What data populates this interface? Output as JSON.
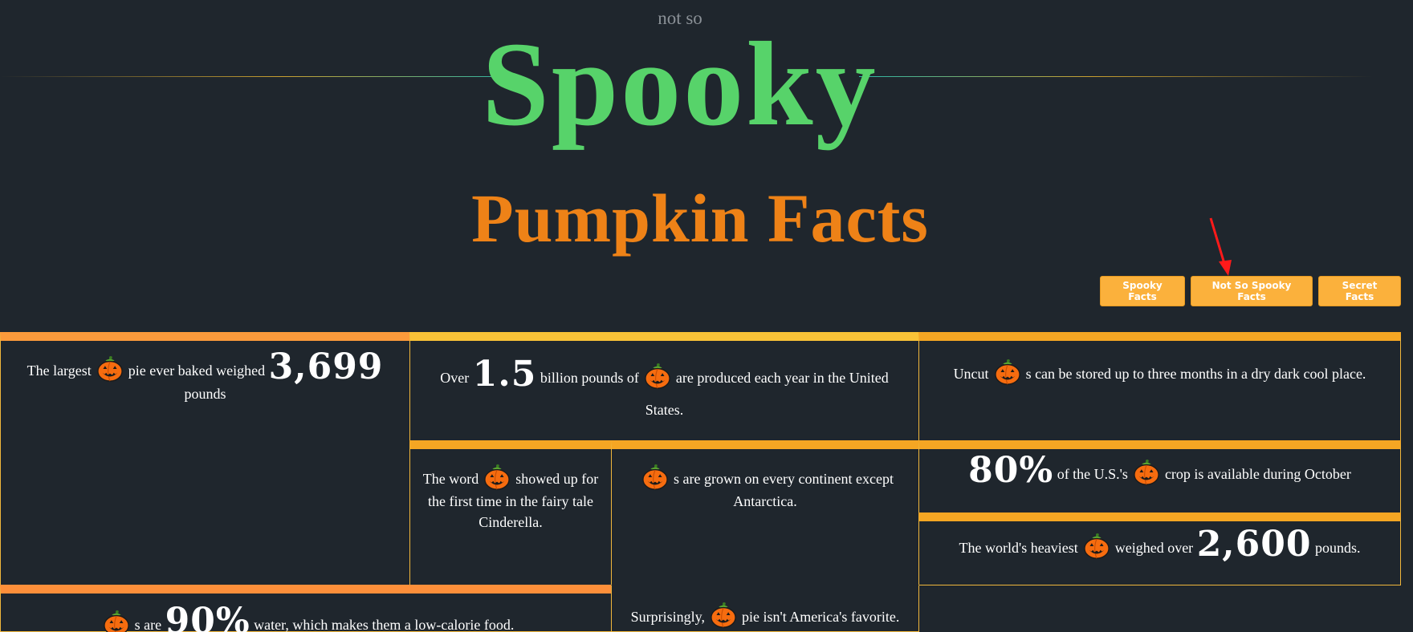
{
  "header": {
    "pre_title": "not so",
    "title": "Spooky",
    "subtitle": "Pumpkin Facts"
  },
  "nav": {
    "spooky_facts": "Spooky Facts",
    "not_so_spooky_facts": "Not So Spooky Facts",
    "secret_facts": "Secret Facts"
  },
  "facts": [
    {
      "a": "The largest",
      "b": "pie ever baked weighed",
      "num": "3,699",
      "c": "pounds"
    },
    {
      "a": "Over",
      "num": "1.5",
      "b": "billion pounds of",
      "c": "are produced each year in the United States."
    },
    {
      "a": "Uncut",
      "b": "s can be stored up to three months in a dry dark cool place."
    },
    {
      "a": "The word",
      "b": "showed up for the first time in the fairy tale Cinderella."
    },
    {
      "b": "s are grown on every continent except Antarctica."
    },
    {
      "num": "80%",
      "a": "of the U.S.'s",
      "b": "crop is available during October"
    },
    {
      "a": "The world's heaviest",
      "b": "weighed over",
      "num": "2,600",
      "c": "pounds."
    },
    {
      "b": "s are",
      "num": "90%",
      "c": "water, which makes them a low-calorie food."
    },
    {
      "a": "Surprisingly,",
      "b": "pie isn't America's favorite."
    }
  ],
  "colors": {
    "background": "#1f262d",
    "title_green": "#57d36a",
    "subtitle_orange": "#ee8217",
    "button": "#fbb13c"
  },
  "icons": {
    "pumpkin": "jack-o-lantern-icon",
    "annotation": "red-arrow-icon"
  }
}
